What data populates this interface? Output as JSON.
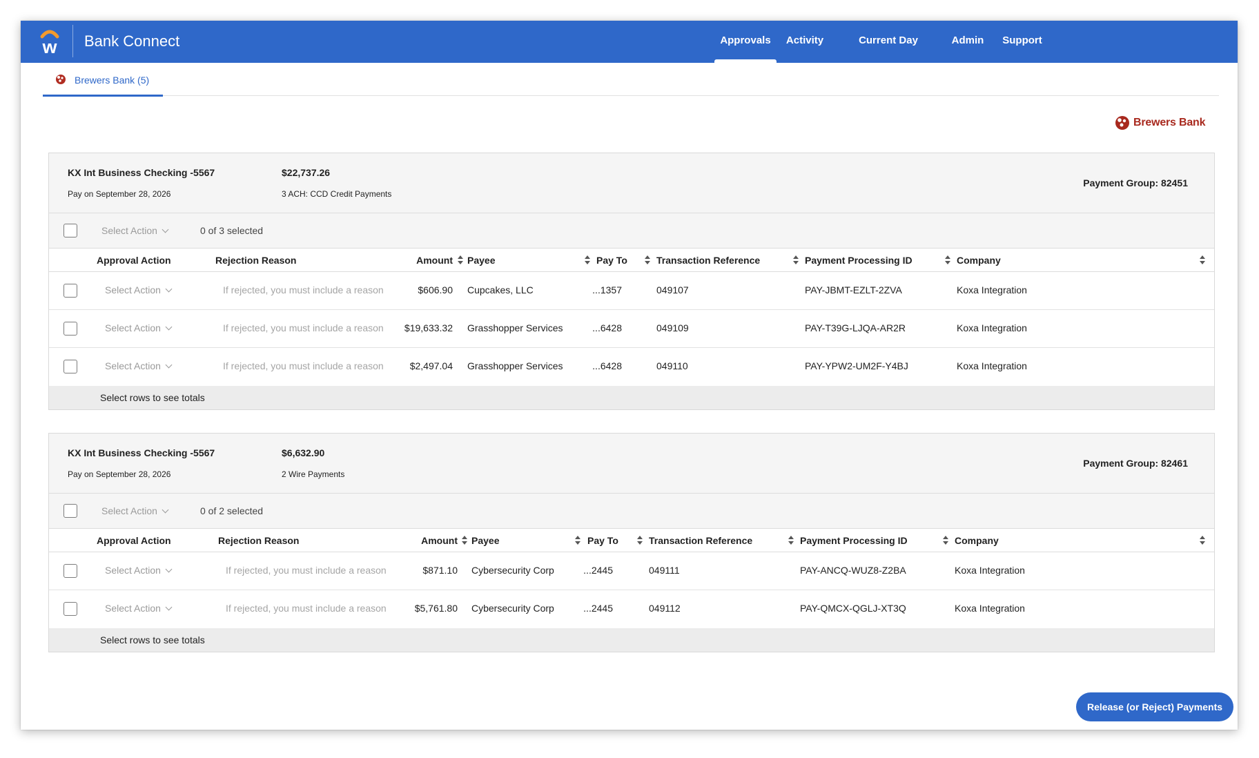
{
  "header": {
    "app_title": "Bank Connect",
    "nav": [
      {
        "label": "Approvals",
        "active": true
      },
      {
        "label": "Activity"
      },
      {
        "label": "Current Day Reporting"
      },
      {
        "label": "Admin"
      },
      {
        "label": "Support"
      }
    ]
  },
  "tab": {
    "label": "Brewers Bank (5)"
  },
  "brand": {
    "name": "Brewers Bank",
    "color": "#a8291e"
  },
  "accent_color": "#2f68c9",
  "columns": {
    "approval_action": "Approval Action",
    "rejection_reason": "Rejection Reason",
    "amount": "Amount",
    "payee": "Payee",
    "pay_to": "Pay To",
    "transaction_reference": "Transaction Reference",
    "payment_processing_id": "Payment Processing ID",
    "company": "Company"
  },
  "select_action_label": "Select Action",
  "reason_placeholder": "If rejected, you must include a reason",
  "totals_label": "Select rows to see totals",
  "groups": [
    {
      "account": "KX Int Business Checking -5567",
      "pay_on": "Pay on September 28, 2026",
      "amount": "$22,737.26",
      "description": "3 ACH: CCD Credit Payments",
      "payment_group": "Payment Group: 82451",
      "selected_count": "0 of 3 selected",
      "rows": [
        {
          "amount": "$606.90",
          "payee": "Cupcakes, LLC",
          "pay_to": "...1357",
          "ref": "049107",
          "ppid": "PAY-JBMT-EZLT-2ZVA",
          "company": "Koxa Integration"
        },
        {
          "amount": "$19,633.32",
          "payee": "Grasshopper Services",
          "pay_to": "...6428",
          "ref": "049109",
          "ppid": "PAY-T39G-LJQA-AR2R",
          "company": "Koxa Integration"
        },
        {
          "amount": "$2,497.04",
          "payee": "Grasshopper Services",
          "pay_to": "...6428",
          "ref": "049110",
          "ppid": "PAY-YPW2-UM2F-Y4BJ",
          "company": "Koxa Integration"
        }
      ]
    },
    {
      "account": "KX Int Business Checking -5567",
      "pay_on": "Pay on September 28, 2026",
      "amount": "$6,632.90",
      "description": "2 Wire Payments",
      "payment_group": "Payment Group: 82461",
      "selected_count": "0 of 2 selected",
      "rows": [
        {
          "amount": "$871.10",
          "payee": "Cybersecurity Corp",
          "pay_to": "...2445",
          "ref": "049111",
          "ppid": "PAY-ANCQ-WUZ8-Z2BA",
          "company": "Koxa Integration"
        },
        {
          "amount": "$5,761.80",
          "payee": "Cybersecurity Corp",
          "pay_to": "...2445",
          "ref": "049112",
          "ppid": "PAY-QMCX-QGLJ-XT3Q",
          "company": "Koxa Integration"
        }
      ]
    }
  ],
  "release_button": "Release (or Reject) Payments"
}
